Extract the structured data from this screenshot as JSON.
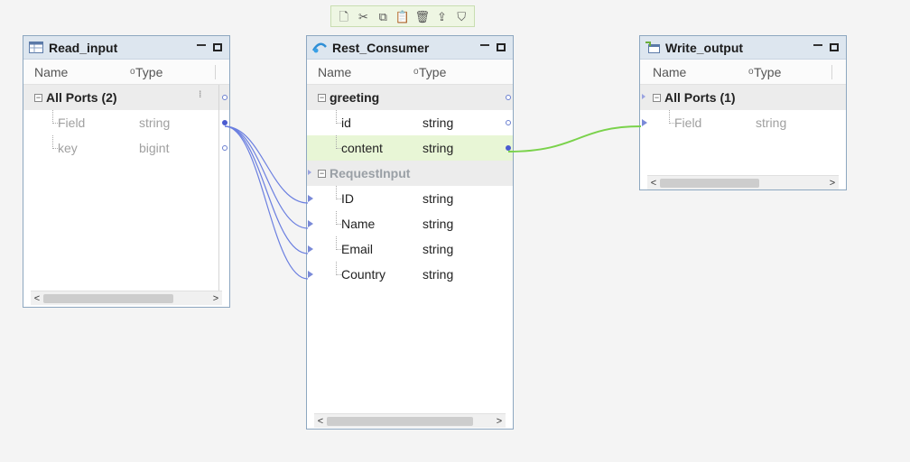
{
  "toolbar": {
    "icons": [
      "new-icon",
      "cut-icon",
      "copy-icon",
      "paste-icon",
      "delete-icon",
      "export-icon",
      "filter-icon"
    ]
  },
  "read_input": {
    "title": "Read_input",
    "col_name": "Name",
    "col_type": "Type",
    "group": "All Ports (2)",
    "fields": [
      {
        "name": "Field",
        "type": "string"
      },
      {
        "name": "key",
        "type": "bigint"
      }
    ]
  },
  "rest_consumer": {
    "title": "Rest_Consumer",
    "col_name": "Name",
    "col_type": "Type",
    "output_group": "greeting",
    "output_fields": [
      {
        "name": "id",
        "type": "string"
      },
      {
        "name": "content",
        "type": "string"
      }
    ],
    "input_group": "RequestInput",
    "input_fields": [
      {
        "name": "ID",
        "type": "string"
      },
      {
        "name": "Name",
        "type": "string"
      },
      {
        "name": "Email",
        "type": "string"
      },
      {
        "name": "Country",
        "type": "string"
      }
    ]
  },
  "write_output": {
    "title": "Write_output",
    "col_name": "Name",
    "col_type": "Type",
    "group": "All Ports (1)",
    "fields": [
      {
        "name": "Field",
        "type": "string"
      }
    ]
  },
  "colors": {
    "canvas": "#f4f4f4",
    "header": "#dde6ef",
    "link_blue": "#6b7fe0",
    "link_green": "#7ad24b",
    "highlight_row": "#e8f6d6"
  }
}
